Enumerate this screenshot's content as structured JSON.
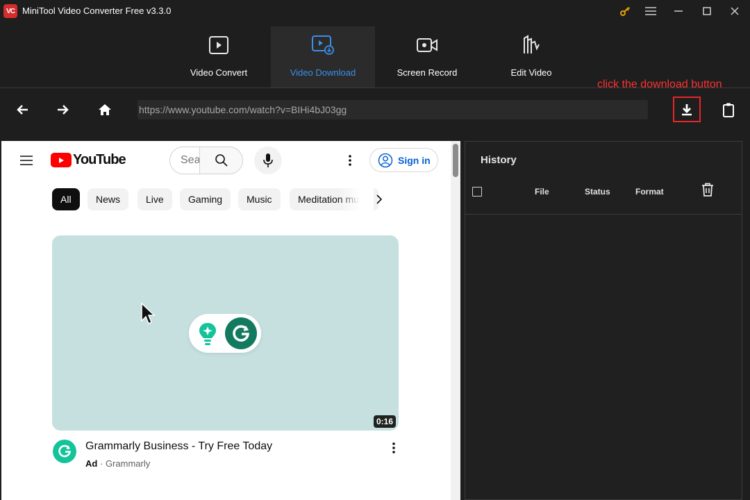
{
  "app": {
    "title": "MiniTool Video Converter Free v3.3.0",
    "logo_text": "VC"
  },
  "nav": {
    "tabs": [
      {
        "label": "Video Convert",
        "icon": "video-convert-icon",
        "active": false
      },
      {
        "label": "Video Download",
        "icon": "video-download-icon",
        "active": true
      },
      {
        "label": "Screen Record",
        "icon": "screen-record-icon",
        "active": false
      },
      {
        "label": "Edit Video",
        "icon": "edit-video-icon",
        "active": false
      }
    ]
  },
  "toolbar": {
    "url": "https://www.youtube.com/watch?v=BIHi4bJ03gg",
    "hint": "click the download button"
  },
  "youtube": {
    "logo_text": "YouTube",
    "search_placeholder": "Search",
    "signin_label": "Sign in",
    "chips": [
      "All",
      "News",
      "Live",
      "Gaming",
      "Music",
      "Meditation music"
    ],
    "video": {
      "duration": "0:16",
      "title": "Grammarly Business - Try Free Today",
      "ad_label": "Ad",
      "separator": "·",
      "channel": "Grammarly"
    }
  },
  "history": {
    "title": "History",
    "columns": [
      "File",
      "Status",
      "Format"
    ]
  },
  "colors": {
    "accent": "#3b8fe8",
    "hint_red": "#ff3030",
    "youtube_red": "#ff0000",
    "grammarly_green": "#15c39a"
  }
}
